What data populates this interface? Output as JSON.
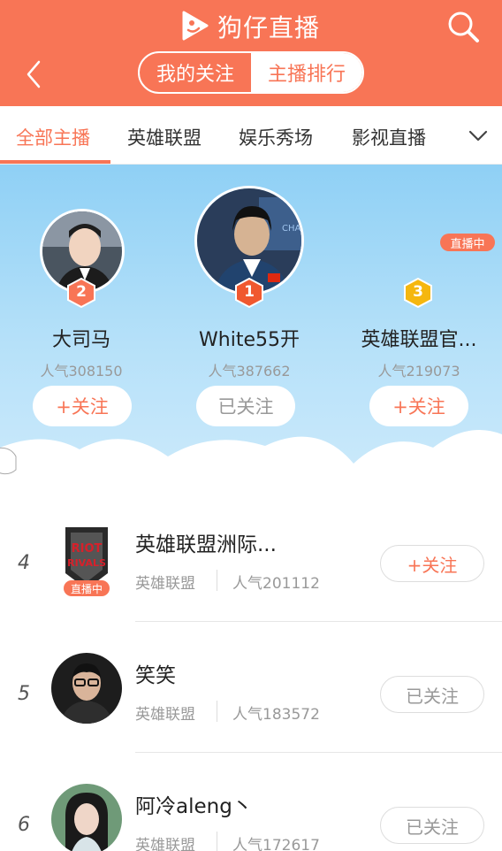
{
  "header": {
    "app_title": "狗仔直播",
    "segment": {
      "left_label": "我的关注",
      "right_label": "主播排行",
      "selected": "主播排行"
    }
  },
  "tabs": [
    {
      "label": "全部主播",
      "active": true
    },
    {
      "label": "英雄联盟",
      "active": false
    },
    {
      "label": "娱乐秀场",
      "active": false
    },
    {
      "label": "影视直播",
      "active": false
    }
  ],
  "podium": [
    {
      "rank": "2",
      "name": "大司马",
      "popularity": "人气308150",
      "button": "+关注",
      "followed": false
    },
    {
      "rank": "1",
      "name": "White55开",
      "popularity": "人气387662",
      "button": "已关注",
      "followed": true
    },
    {
      "rank": "3",
      "name": "英雄联盟官...",
      "popularity": "人气219073",
      "button": "+关注",
      "followed": false,
      "live_label": "直播中"
    }
  ],
  "list": [
    {
      "rank": "4",
      "name": "英雄联盟洲际...",
      "category": "英雄联盟",
      "popularity": "人气201112",
      "button": "+关注",
      "followed": false,
      "live_label": "直播中"
    },
    {
      "rank": "5",
      "name": "笑笑",
      "category": "英雄联盟",
      "popularity": "人气183572",
      "button": "已关注",
      "followed": true
    },
    {
      "rank": "6",
      "name": "阿冷aleng丶",
      "category": "英雄联盟",
      "popularity": "人气172617",
      "button": "已关注",
      "followed": true
    }
  ],
  "colors": {
    "accent": "#f87556",
    "sky": "#8fd0f5",
    "gold": "#f5b70f"
  }
}
